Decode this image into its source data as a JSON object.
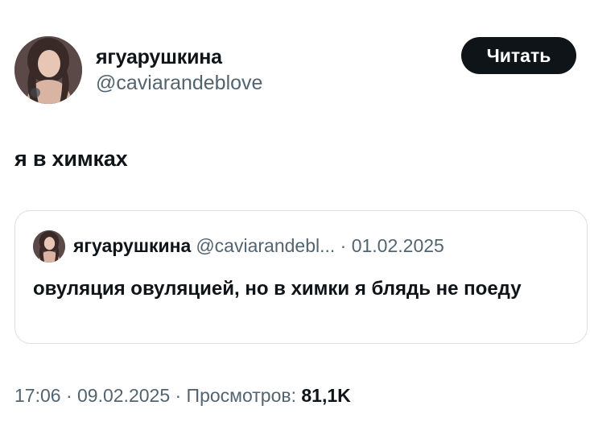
{
  "author": {
    "display_name": "ягуарушкина",
    "handle": "@caviarandeblove",
    "avatar_icon": "profile-photo"
  },
  "read_button": {
    "label": "Читать"
  },
  "tweet": {
    "text": "я в химках"
  },
  "quote": {
    "display_name": "ягуарушкина",
    "handle_date": "@caviarandebl... · 01.02.2025",
    "text": "овуляция овуляцией, но в химки я блядь не поеду"
  },
  "meta": {
    "timestamp": "17:06 · 09.02.2025 · Просмотров: ",
    "views": "81,1K"
  },
  "colors": {
    "primary_text": "#0f1419",
    "secondary_text": "#536471",
    "button_bg": "#0f1419",
    "border": "#dbe1e6"
  }
}
